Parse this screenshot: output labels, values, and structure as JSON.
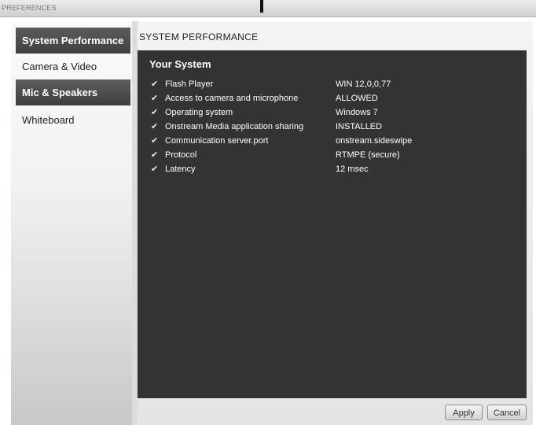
{
  "window": {
    "title": "PREFERENCES"
  },
  "sidebar": {
    "items": [
      {
        "label": "System Performance"
      },
      {
        "label": "Camera & Video"
      },
      {
        "label": "Mic & Speakers"
      },
      {
        "label": "Whiteboard"
      }
    ]
  },
  "main": {
    "section_title": "SYSTEM PERFORMANCE",
    "panel_heading": "Your System",
    "rows": [
      {
        "label": "Flash Player",
        "value": "WIN 12,0,0,77"
      },
      {
        "label": "Access to camera and microphone",
        "value": "ALLOWED"
      },
      {
        "label": "Operating system",
        "value": "Windows 7"
      },
      {
        "label": "Onstream Media application sharing",
        "value": "INSTALLED"
      },
      {
        "label": "Communication server.port",
        "value": "onstream.sideswipe"
      },
      {
        "label": "Protocol",
        "value": "RTMPE (secure)"
      },
      {
        "label": "Latency",
        "value": "12 msec"
      }
    ]
  },
  "footer": {
    "apply_label": "Apply",
    "cancel_label": "Cancel"
  },
  "icons": {
    "row_status": "checkmark-icon"
  },
  "colors": {
    "panel_bg": "#333333",
    "nav_active_bg": "#4a4a4a"
  }
}
